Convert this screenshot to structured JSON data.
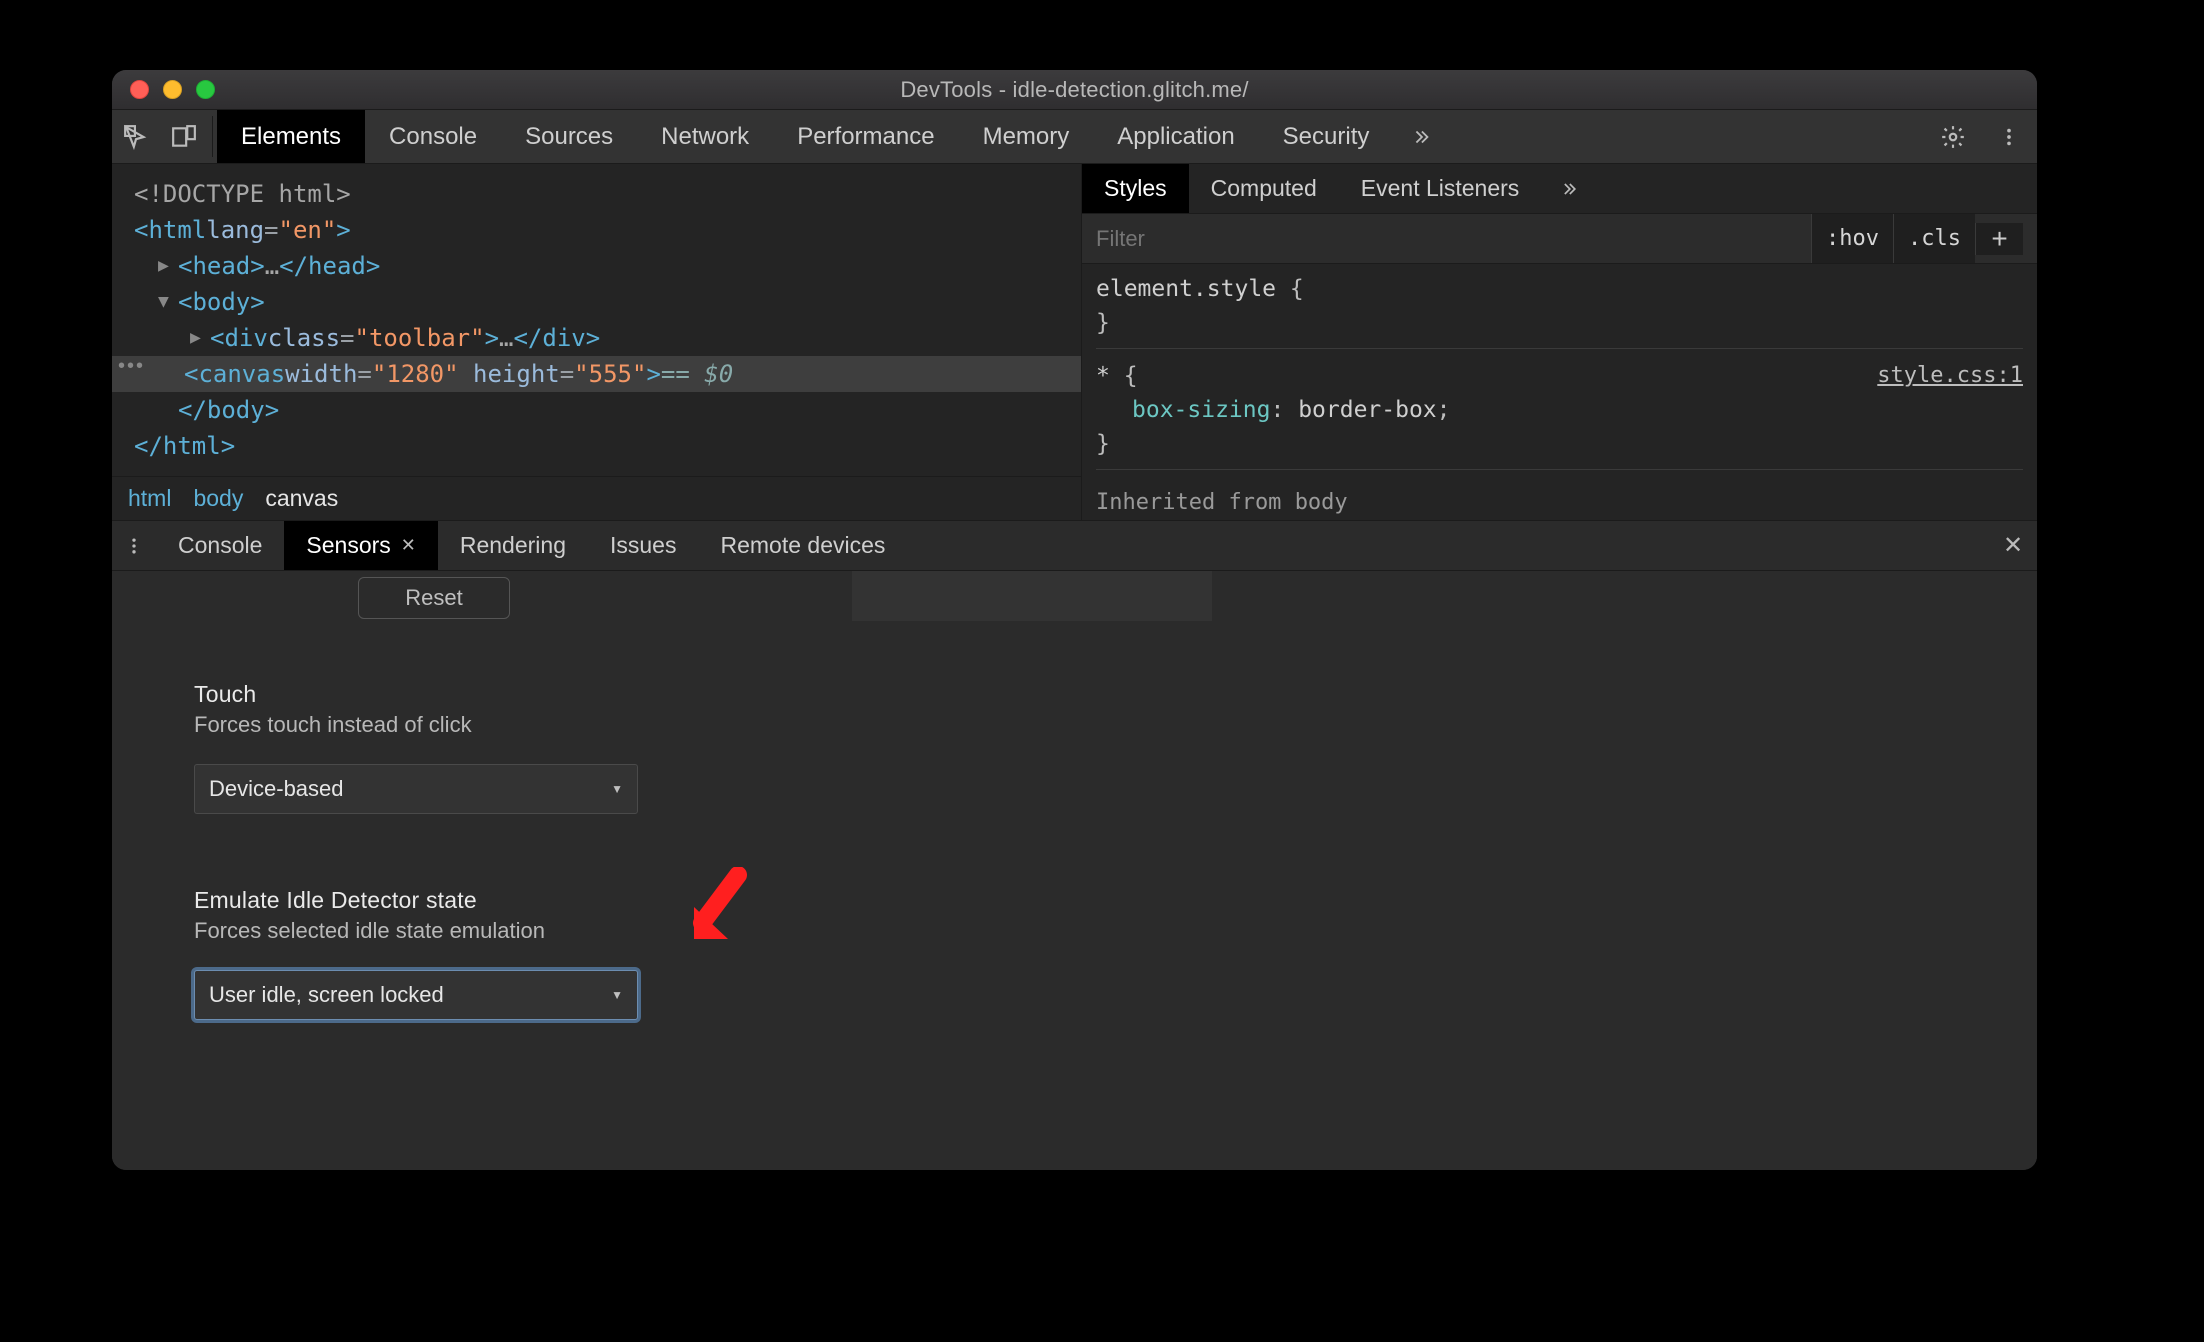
{
  "window": {
    "title": "DevTools - idle-detection.glitch.me/"
  },
  "toolbar": {
    "tabs": [
      "Elements",
      "Console",
      "Sources",
      "Network",
      "Performance",
      "Memory",
      "Application",
      "Security"
    ],
    "active_index": 0
  },
  "dom": {
    "doctype": "<!DOCTYPE html>",
    "html_open": "<html lang=\"en\">",
    "head": "<head>…</head>",
    "body_open": "<body>",
    "div_line_prefix": "<div class=",
    "div_class_val": "toolbar",
    "div_line_suffix": ">…</div>",
    "canvas_open": "<canvas width=",
    "canvas_w": "1280",
    "canvas_mid": " height=",
    "canvas_h": "555",
    "canvas_close_tag": ">",
    "eq_hint": "== $0",
    "body_close": "</body>",
    "html_close": "</html>",
    "crumbs": [
      "html",
      "body",
      "canvas"
    ],
    "crumbs_active_index": 2
  },
  "styles": {
    "tabs": [
      "Styles",
      "Computed",
      "Event Listeners"
    ],
    "active_index": 0,
    "filter_placeholder": "Filter",
    "hov": ":hov",
    "cls": ".cls",
    "rule1_sel": "element.style",
    "rule1_open": " {",
    "rule1_close": "}",
    "rule2_sel": "*",
    "rule2_src": "style.css:1",
    "rule2_open": " {",
    "rule2_prop": "box-sizing",
    "rule2_val": "border-box",
    "rule2_close": "}",
    "inherit_label": "Inherited from ",
    "inherit_from": "body"
  },
  "drawer": {
    "tabs": [
      {
        "label": "Console",
        "closable": false
      },
      {
        "label": "Sensors",
        "closable": true
      },
      {
        "label": "Rendering",
        "closable": false
      },
      {
        "label": "Issues",
        "closable": false
      },
      {
        "label": "Remote devices",
        "closable": false
      }
    ],
    "active_index": 1,
    "reset": "Reset",
    "touch": {
      "title": "Touch",
      "desc": "Forces touch instead of click",
      "value": "Device-based"
    },
    "idle": {
      "title": "Emulate Idle Detector state",
      "desc": "Forces selected idle state emulation",
      "value": "User idle, screen locked"
    }
  }
}
